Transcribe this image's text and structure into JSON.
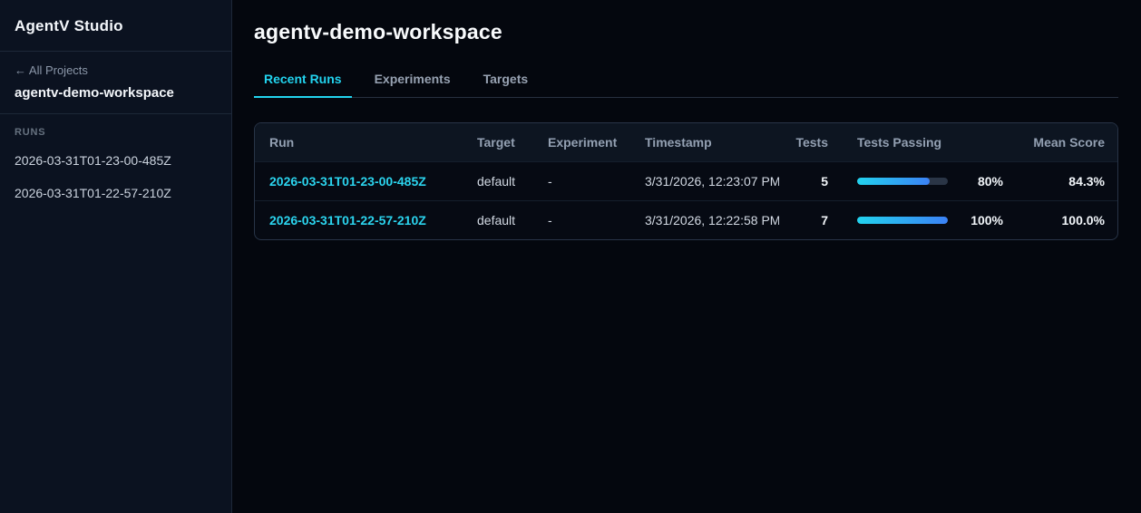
{
  "sidebar": {
    "app_title": "AgentV Studio",
    "back_link": "← All Projects",
    "workspace_name": "agentv-demo-workspace",
    "runs_label": "RUNS",
    "runs": [
      "2026-03-31T01-23-00-485Z",
      "2026-03-31T01-22-57-210Z"
    ]
  },
  "main": {
    "title": "agentv-demo-workspace",
    "tabs": [
      {
        "label": "Recent Runs",
        "active": true
      },
      {
        "label": "Experiments",
        "active": false
      },
      {
        "label": "Targets",
        "active": false
      }
    ],
    "table": {
      "columns": [
        "Run",
        "Target",
        "Experiment",
        "Timestamp",
        "Tests",
        "Tests Passing",
        "Mean Score"
      ],
      "rows": [
        {
          "run": "2026-03-31T01-23-00-485Z",
          "target": "default",
          "experiment": "-",
          "timestamp": "3/31/2026, 12:23:07 PM",
          "tests": "5",
          "passing_pct": 80,
          "passing_label": "80%",
          "mean_score": "84.3%"
        },
        {
          "run": "2026-03-31T01-22-57-210Z",
          "target": "default",
          "experiment": "-",
          "timestamp": "3/31/2026, 12:22:58 PM",
          "tests": "7",
          "passing_pct": 100,
          "passing_label": "100%",
          "mean_score": "100.0%"
        }
      ]
    }
  },
  "colors": {
    "accent_cyan": "#22d3ee",
    "accent_blue": "#3b82f6",
    "sidebar_bg": "#0b1220",
    "main_bg": "#04070e",
    "table_header_bg": "#0d1521",
    "border": "#283447"
  }
}
